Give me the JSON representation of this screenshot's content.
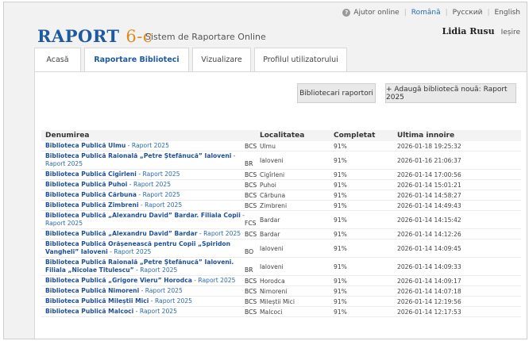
{
  "topbar": {
    "help_label": "Ajutor online",
    "lang_ro": "Română",
    "lang_ru": "Русский",
    "lang_en": "English"
  },
  "header": {
    "logo_main": "RAPORT",
    "logo_accent": "6-c",
    "subtitle": "Sistem de Raportare Online",
    "user_name": "Lidia Rusu",
    "logout_label": "Ieșire"
  },
  "tabs": [
    {
      "label": "Acasă"
    },
    {
      "label": "Raportare Biblioteci",
      "active": true
    },
    {
      "label": "Vizualizare"
    },
    {
      "label": "Profilul utilizatorului"
    }
  ],
  "actions": {
    "librarians_label": "Bibliotecari raportori",
    "add_label": "+ Adaugă bibliotecă nouă: Raport 2025"
  },
  "table": {
    "headers": {
      "name": "Denumirea",
      "locality": "Localitatea",
      "completed": "Completat",
      "last_update": "Ultima innoire"
    },
    "rows": [
      {
        "lib": "Biblioteca Publică Ulmu",
        "rep": "Raport 2025",
        "type": "BCS",
        "loc": "Ulmu",
        "pct": "91%",
        "date": "2026-01-18 19:25:32"
      },
      {
        "lib": "Biblioteca Publică Raională „Petre Ștefănucă” Ialoveni",
        "rep": "Raport 2025",
        "type": "BR",
        "loc": "Ialoveni",
        "pct": "91%",
        "date": "2026-01-16 21:06:37"
      },
      {
        "lib": "Biblioteca Publică Cigîrleni",
        "rep": "Raport 2025",
        "type": "BCS",
        "loc": "Cigîrleni",
        "pct": "91%",
        "date": "2026-01-14 17:00:56"
      },
      {
        "lib": "Biblioteca Publică Puhoi",
        "rep": "Raport 2025",
        "type": "BCS",
        "loc": "Puhoi",
        "pct": "91%",
        "date": "2026-01-14 15:01:21"
      },
      {
        "lib": "Biblioteca Publică Cărbuna",
        "rep": "Raport 2025",
        "type": "BCS",
        "loc": "Cărbuna",
        "pct": "91%",
        "date": "2026-01-14 14:58:27"
      },
      {
        "lib": "Biblioteca Publică Zimbreni",
        "rep": "Raport 2025",
        "type": "BCS",
        "loc": "Zimbreni",
        "pct": "91%",
        "date": "2026-01-14 14:49:43"
      },
      {
        "lib": "Biblioteca Publică „Alexandru David” Bardar. Filiala Copii",
        "rep": "Raport 2025",
        "type": "FCS",
        "loc": "Bardar",
        "pct": "91%",
        "date": "2026-01-14 14:15:42"
      },
      {
        "lib": "Biblioteca Publică „Alexandru David” Bardar",
        "rep": "Raport 2025",
        "type": "BCS",
        "loc": "Bardar",
        "pct": "91%",
        "date": "2026-01-14 14:12:26"
      },
      {
        "lib": "Biblioteca Publică Orășenească pentru Copii „Spiridon Vangheli” Ialoveni",
        "rep": "Raport 2025",
        "type": "BO",
        "loc": "Ialoveni",
        "pct": "91%",
        "date": "2026-01-14 14:09:45"
      },
      {
        "lib": "Biblioteca Publică Raională „Petre Ștefănucă” Ialoveni. Filiala „Nicolae Titulescu”",
        "rep": "Raport 2025",
        "type": "BR",
        "loc": "Ialoveni",
        "pct": "91%",
        "date": "2026-01-14 14:09:33"
      },
      {
        "lib": "Biblioteca Publică „Grigore Vieru” Horodca",
        "rep": "Raport 2025",
        "type": "BCS",
        "loc": "Horodca",
        "pct": "91%",
        "date": "2026-01-14 14:09:17"
      },
      {
        "lib": "Biblioteca Publică Nimoreni",
        "rep": "Raport 2025",
        "type": "BCS",
        "loc": "Nimoreni",
        "pct": "91%",
        "date": "2026-01-14 14:07:18"
      },
      {
        "lib": "Biblioteca Publică Mileștii Mici",
        "rep": "Raport 2025",
        "type": "BCS",
        "loc": "Mileștii Mici",
        "pct": "91%",
        "date": "2026-01-14 12:19:56"
      },
      {
        "lib": "Biblioteca Publică Malcoci",
        "rep": "Raport 2025",
        "type": "BCS",
        "loc": "Malcoci",
        "pct": "91%",
        "date": "2026-01-14 12:17:53"
      }
    ]
  }
}
